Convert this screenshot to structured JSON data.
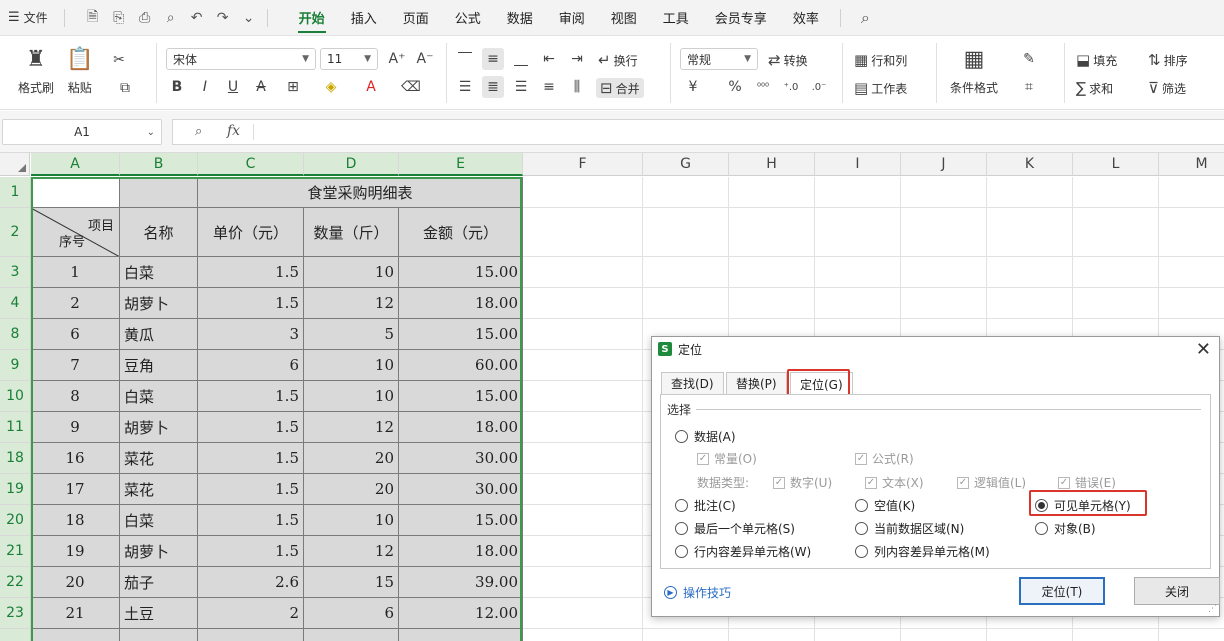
{
  "menu": {
    "file_label": "文件",
    "tabs": [
      "开始",
      "插入",
      "页面",
      "公式",
      "数据",
      "审阅",
      "视图",
      "工具",
      "会员专享",
      "效率"
    ],
    "active_tab": 0
  },
  "ribbon": {
    "format_painter": "格式刷",
    "paste": "粘贴",
    "font_name": "宋体",
    "font_size": "11",
    "wrap": "换行",
    "merge": "合并",
    "number_format": "常规",
    "convert": "转换",
    "rows_cols": "行和列",
    "worksheet": "工作表",
    "conditional_format": "条件格式",
    "fill": "填充",
    "sort": "排序",
    "sum": "求和",
    "filter": "筛选"
  },
  "formula_bar": {
    "cell_ref": "A1",
    "fx": "fx",
    "content": ""
  },
  "columns": [
    "A",
    "B",
    "C",
    "D",
    "E",
    "F",
    "G",
    "H",
    "I",
    "J",
    "K",
    "L",
    "M"
  ],
  "rows": [
    "1",
    "2",
    "3",
    "4",
    "8",
    "9",
    "10",
    "11",
    "18",
    "19",
    "20",
    "21",
    "22",
    "23"
  ],
  "table": {
    "title": "食堂采购明细表",
    "diag_top": "项目",
    "diag_bottom": "序号",
    "headers": [
      "名称",
      "单价（元）",
      "数量（斤）",
      "金额（元）"
    ],
    "data": [
      [
        "1",
        "白菜",
        "1.5",
        "10",
        "15.00"
      ],
      [
        "2",
        "胡萝卜",
        "1.5",
        "12",
        "18.00"
      ],
      [
        "6",
        "黄瓜",
        "3",
        "5",
        "15.00"
      ],
      [
        "7",
        "豆角",
        "6",
        "10",
        "60.00"
      ],
      [
        "8",
        "白菜",
        "1.5",
        "10",
        "15.00"
      ],
      [
        "9",
        "胡萝卜",
        "1.5",
        "12",
        "18.00"
      ],
      [
        "16",
        "菜花",
        "1.5",
        "20",
        "30.00"
      ],
      [
        "17",
        "菜花",
        "1.5",
        "20",
        "30.00"
      ],
      [
        "18",
        "白菜",
        "1.5",
        "10",
        "15.00"
      ],
      [
        "19",
        "胡萝卜",
        "1.5",
        "12",
        "18.00"
      ],
      [
        "20",
        "茄子",
        "2.6",
        "15",
        "39.00"
      ],
      [
        "21",
        "土豆",
        "2",
        "6",
        "12.00"
      ]
    ]
  },
  "dialog": {
    "title": "定位",
    "tabs": [
      "查找(D)",
      "替换(P)",
      "定位(G)"
    ],
    "active_tab": 2,
    "group_label": "选择",
    "options": {
      "data": "数据(A)",
      "constant": "常量(O)",
      "formula": "公式(R)",
      "data_type_label": "数据类型:",
      "number": "数字(U)",
      "text": "文本(X)",
      "logical": "逻辑值(L)",
      "error": "错误(E)",
      "comment": "批注(C)",
      "blank": "空值(K)",
      "visible_cells": "可见单元格(Y)",
      "last_cell": "最后一个单元格(S)",
      "current_region": "当前数据区域(N)",
      "object": "对象(B)",
      "row_diff": "行内容差异单元格(W)",
      "col_diff": "列内容差异单元格(M)"
    },
    "selected_option": "visible_cells",
    "tips": "操作技巧",
    "ok_button": "定位(T)",
    "close_button": "关闭"
  },
  "colors": {
    "accent_green": "#1a7f37",
    "highlight_red": "#d9352b",
    "link_blue": "#2b6cc4"
  }
}
